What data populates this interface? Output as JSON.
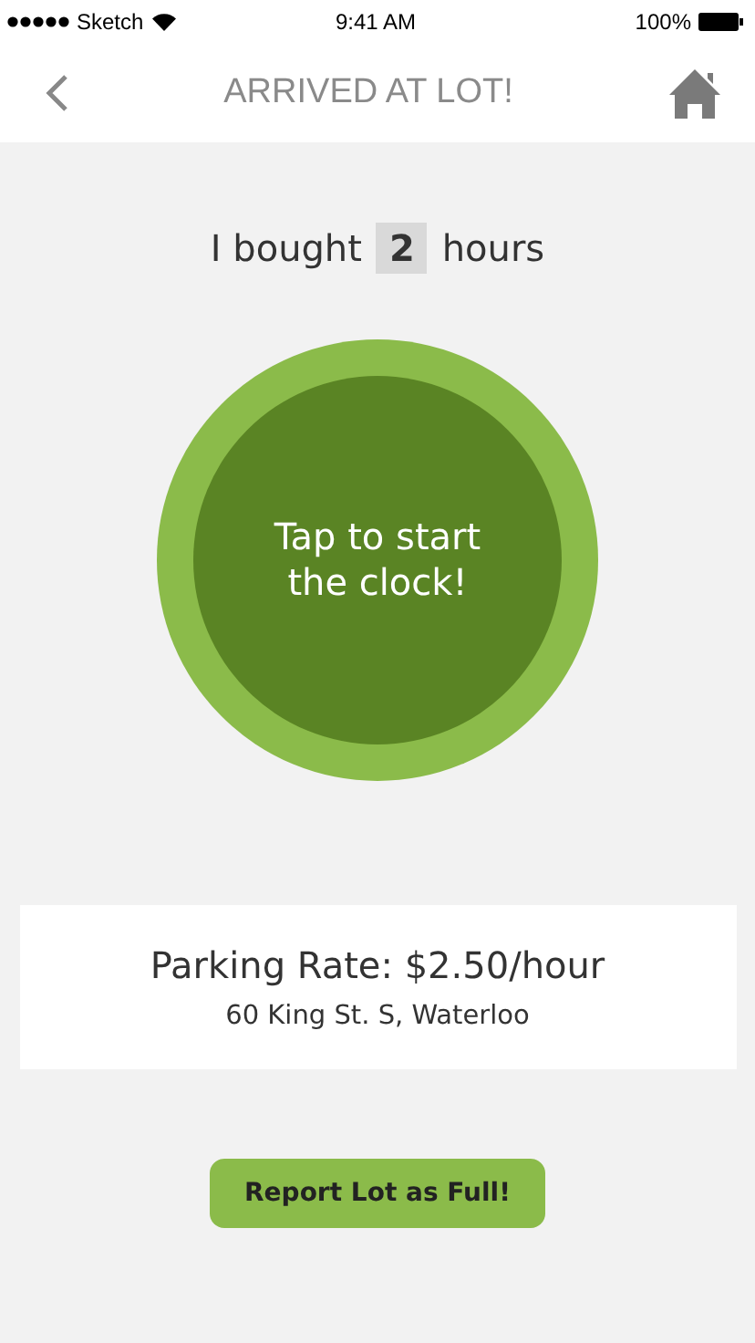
{
  "status_bar": {
    "carrier": "Sketch",
    "time": "9:41 AM",
    "battery": "100%"
  },
  "nav": {
    "title": "ARRIVED AT LOT!"
  },
  "purchase": {
    "prefix": "I bought",
    "hours": "2",
    "suffix": "hours"
  },
  "clock_button": {
    "label": "Tap to start the clock!"
  },
  "lot_card": {
    "rate": "Parking Rate: $2.50/hour",
    "address": "60 King St. S, Waterloo"
  },
  "report_button": {
    "label": "Report Lot as Full!"
  }
}
